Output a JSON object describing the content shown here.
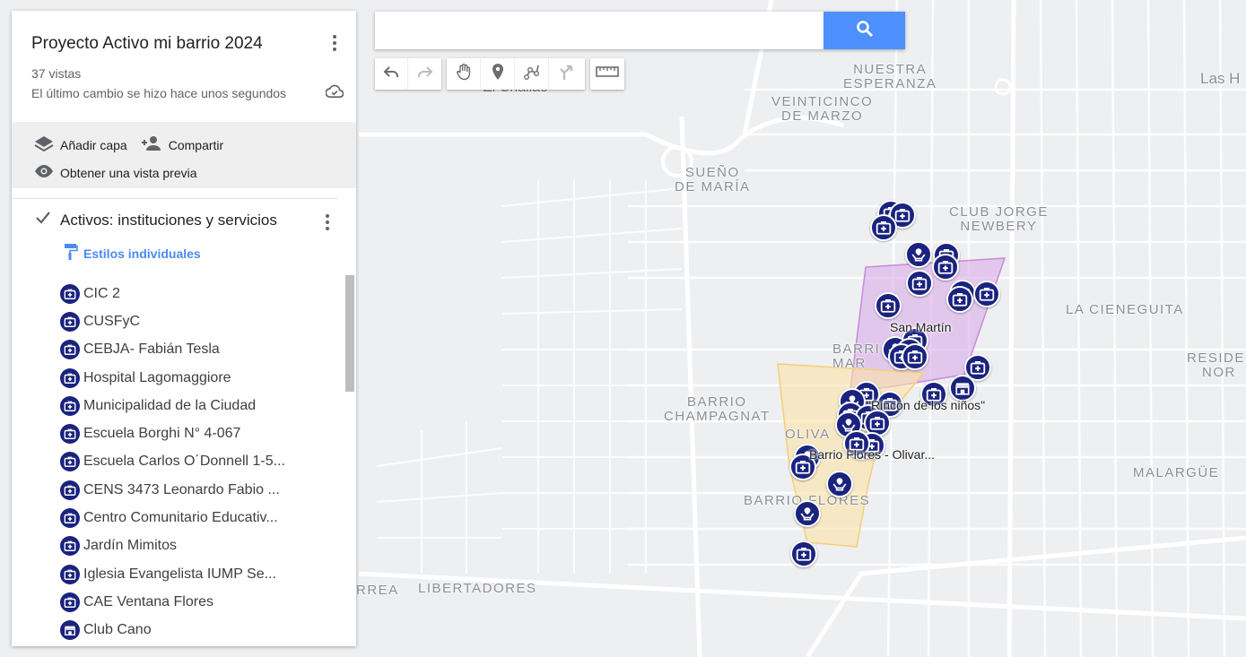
{
  "map": {
    "title": "Proyecto Activo mi barrio 2024",
    "views": "37 vistas",
    "last_change": "El último cambio se hizo hace unos segundos"
  },
  "actions": {
    "add_layer": "Añadir capa",
    "share": "Compartir",
    "preview": "Obtener una vista previa"
  },
  "layer": {
    "title": "Activos: instituciones y servicios",
    "style_link": "Estilos individuales",
    "items": [
      {
        "label": "CIC 2",
        "icon": "medical-icon"
      },
      {
        "label": "CUSFyC",
        "icon": "medical-icon"
      },
      {
        "label": "CEBJA- Fabián Tesla",
        "icon": "medical-icon"
      },
      {
        "label": "Hospital Lagomaggiore",
        "icon": "medical-icon"
      },
      {
        "label": "Municipalidad de la Ciudad",
        "icon": "medical-icon"
      },
      {
        "label": "Escuela Borghi N° 4-067",
        "icon": "medical-icon"
      },
      {
        "label": "Escuela Carlos O´Donnell 1-5...",
        "icon": "medical-icon"
      },
      {
        "label": "CENS 3473 Leonardo Fabio ...",
        "icon": "medical-icon"
      },
      {
        "label": "Centro Comunitario Educativ...",
        "icon": "medical-icon"
      },
      {
        "label": "Jardín Mimitos",
        "icon": "medical-icon"
      },
      {
        "label": "Iglesia Evangelista IUMP Se...",
        "icon": "medical-icon"
      },
      {
        "label": "CAE Ventana Flores",
        "icon": "medical-icon"
      },
      {
        "label": "Club Cano",
        "icon": "store-icon"
      }
    ]
  },
  "search": {
    "value": "",
    "placeholder": ""
  },
  "map_labels": {
    "nuestra_esperanza": "NUESTRA\nESPERANZA",
    "veinticinco_de_marzo": "VEINTICINCO\nDE MARZO",
    "el_challao": "El Challao",
    "sueno_de_maria": "SUEÑO\nDE MARÍA",
    "club_jorge_newbery": "CLUB JORGE\nNEWBERY",
    "la_cieneguita": "LA CIENEGUITA",
    "las_heras": "Las H",
    "residencial_norte": "RESIDE\nNOR",
    "barrio_champagnat": "BARRIO\nCHAMPAGNAT",
    "barrio_mar": "BARRI\nMAR",
    "olivar": "OLIVA",
    "barrio_flores": "BARRIO FLORES",
    "malargue": "MALARGÜE",
    "libertadores": "LIBERTADORES",
    "rrea": "RREA"
  },
  "feature_labels": {
    "san_martin": "San Martín",
    "rincon": "\"Rincón de los niños\"",
    "barrio_flores_olivar": "Barrio Flores - Olivar..."
  },
  "colors": {
    "marker": "#1a237e",
    "search_button": "#4d90fe",
    "link": "#4a8af4",
    "polygon_purple": "#d9a6e8",
    "polygon_yellow": "#fbe3a6"
  }
}
